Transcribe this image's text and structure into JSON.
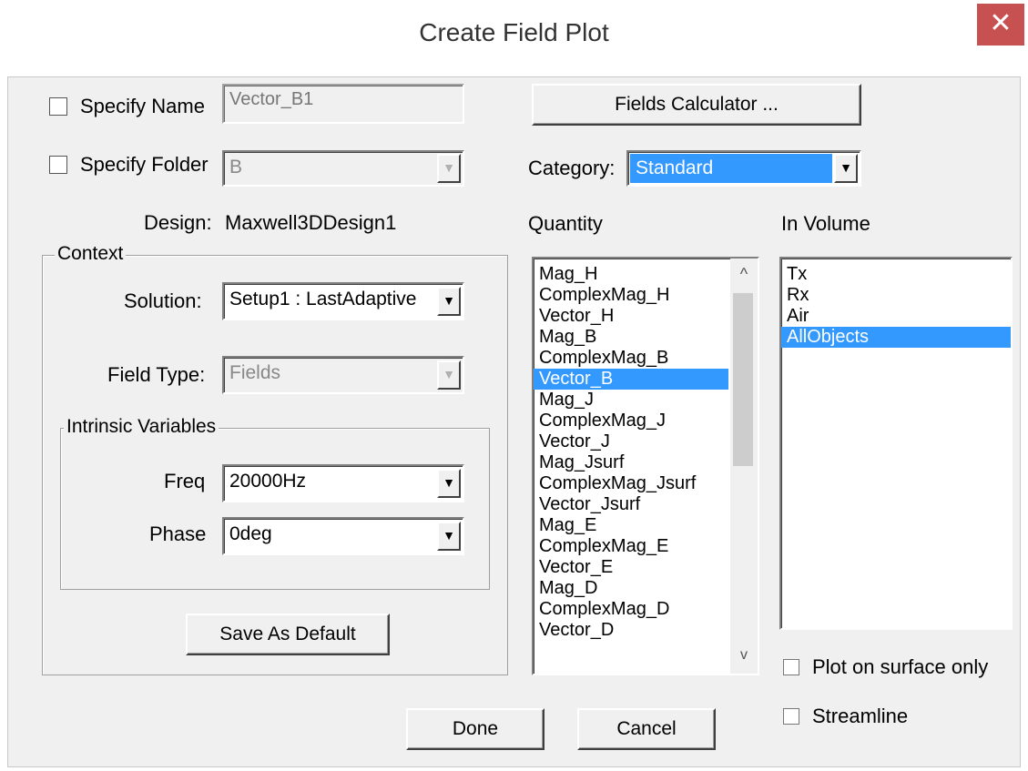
{
  "window": {
    "title": "Create Field Plot",
    "close_glyph": "✕"
  },
  "specify_name": {
    "label": "Specify Name",
    "value": "Vector_B1",
    "checked": false
  },
  "specify_folder": {
    "label": "Specify Folder",
    "value": "B",
    "checked": false
  },
  "fields_calculator": {
    "label": "Fields Calculator ..."
  },
  "category": {
    "label": "Category:",
    "value": "Standard"
  },
  "design": {
    "label": "Design:",
    "value": "Maxwell3DDesign1"
  },
  "quantity": {
    "label": "Quantity",
    "selected": "Vector_B",
    "items": [
      "Mag_H",
      "ComplexMag_H",
      "Vector_H",
      "Mag_B",
      "ComplexMag_B",
      "Vector_B",
      "Mag_J",
      "ComplexMag_J",
      "Vector_J",
      "Mag_Jsurf",
      "ComplexMag_Jsurf",
      "Vector_Jsurf",
      "Mag_E",
      "ComplexMag_E",
      "Vector_E",
      "Mag_D",
      "ComplexMag_D",
      "Vector_D"
    ]
  },
  "in_volume": {
    "label": "In Volume",
    "selected": "AllObjects",
    "items": [
      "Tx",
      "Rx",
      "Air",
      "AllObjects"
    ]
  },
  "context": {
    "legend": "Context",
    "solution": {
      "label": "Solution:",
      "value": "Setup1 : LastAdaptive"
    },
    "field_type": {
      "label": "Field Type:",
      "value": "Fields"
    },
    "intrinsic": {
      "legend": "Intrinsic Variables",
      "freq": {
        "label": "Freq",
        "value": "20000Hz"
      },
      "phase": {
        "label": "Phase",
        "value": "0deg"
      }
    },
    "save_default": "Save As Default"
  },
  "options": {
    "plot_on_surface_only": {
      "label": "Plot on surface only",
      "checked": false
    },
    "streamline": {
      "label": "Streamline",
      "checked": false
    }
  },
  "buttons": {
    "done": "Done",
    "cancel": "Cancel"
  },
  "icons": {
    "dropdown": "▼",
    "scroll_up": "^",
    "scroll_down": "v"
  },
  "colors": {
    "selection": "#3399ff",
    "close_button": "#c75050"
  }
}
